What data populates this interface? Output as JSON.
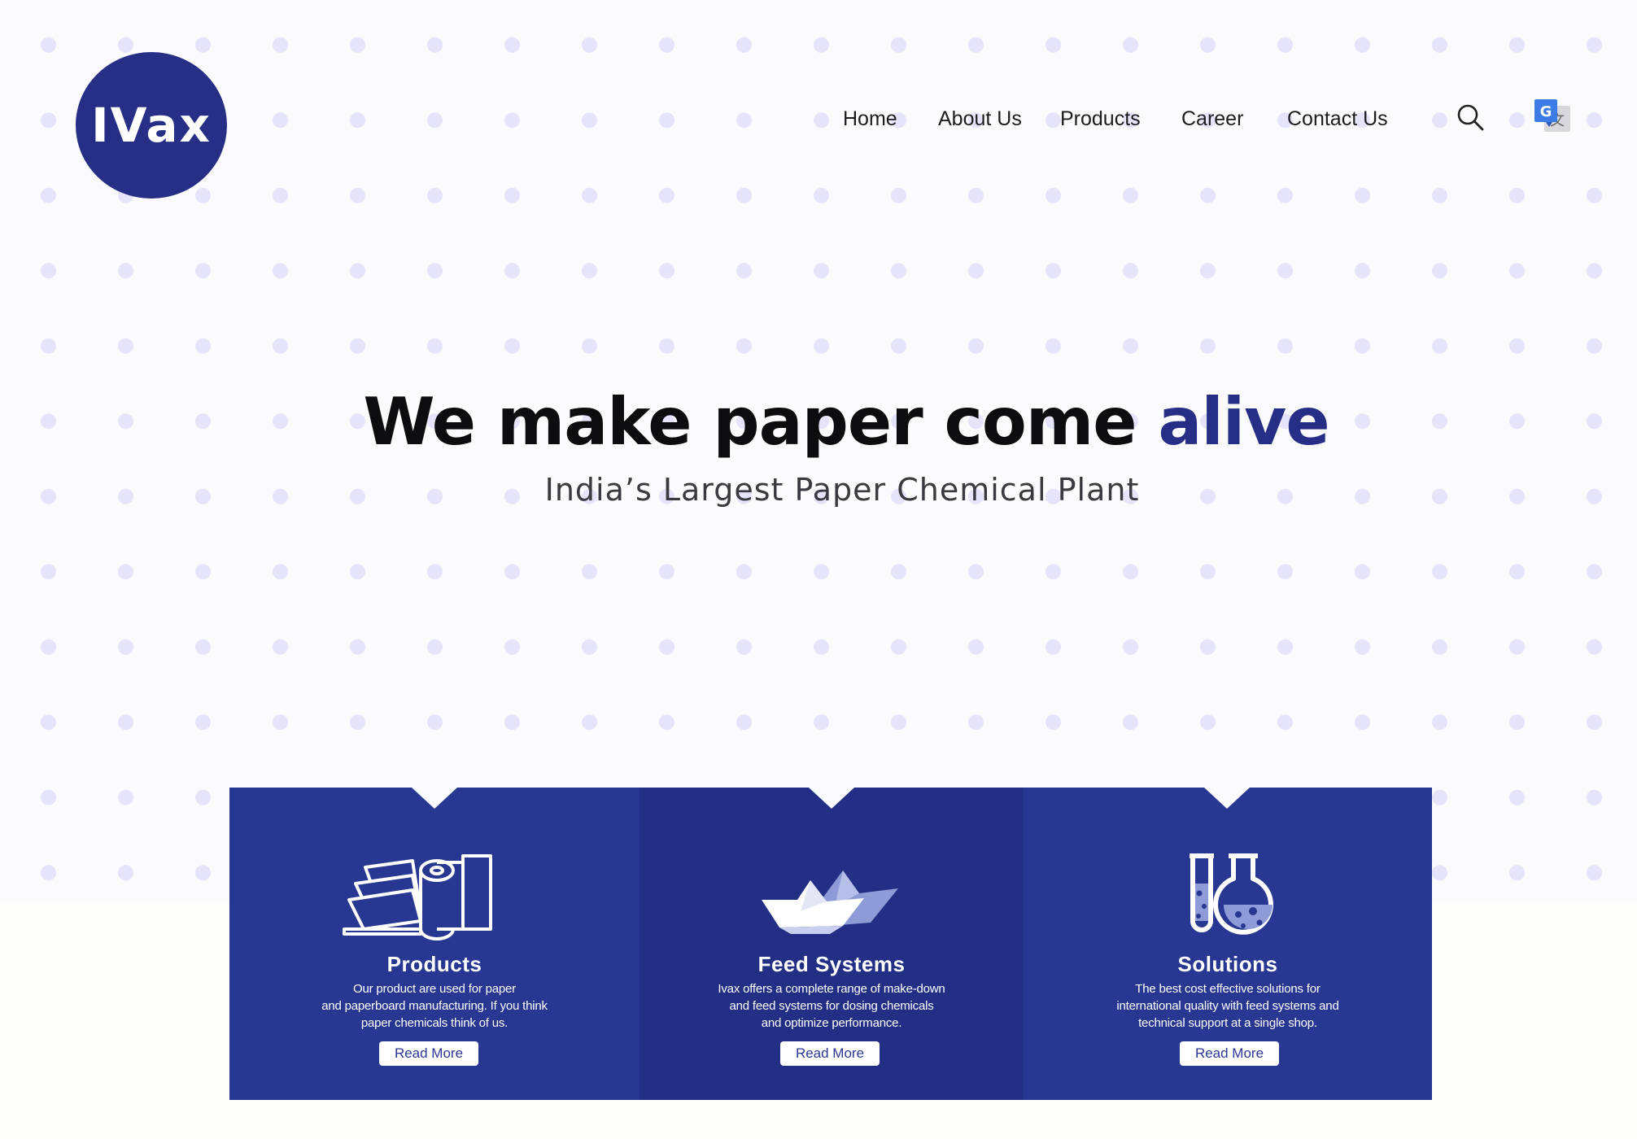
{
  "logo": {
    "text": "IVax"
  },
  "nav": {
    "items": [
      {
        "label": "Home"
      },
      {
        "label": "About Us"
      },
      {
        "label": "Products"
      },
      {
        "label": "Career"
      },
      {
        "label": "Contact Us"
      }
    ],
    "search_icon": "search-icon",
    "translate_icon": "google-translate-icon"
  },
  "hero": {
    "title_main": "We make paper come ",
    "title_accent": "alive",
    "subtitle": "India’s Largest Paper Chemical Plant"
  },
  "cards": [
    {
      "title": "Products",
      "description": [
        "Our product are used for paper",
        "and paperboard manufacturing. If you think",
        "paper chemicals think of us."
      ],
      "button": "Read More",
      "icon": "paper-roll-icon"
    },
    {
      "title": "Feed Systems",
      "description": [
        "Ivax offers a complete range of make-down",
        "and feed systems for dosing chemicals",
        "and optimize performance."
      ],
      "button": "Read More",
      "icon": "paper-boat-icon"
    },
    {
      "title": "Solutions",
      "description": [
        "The best cost effective solutions for",
        "international quality with feed systems and",
        "technical support at a single shop."
      ],
      "button": "Read More",
      "icon": "chemistry-flask-icon"
    }
  ],
  "colors": {
    "brand": "#262e86",
    "card_light": "#283791",
    "card_dark": "#222f84",
    "dots": "#e5e4fa"
  }
}
